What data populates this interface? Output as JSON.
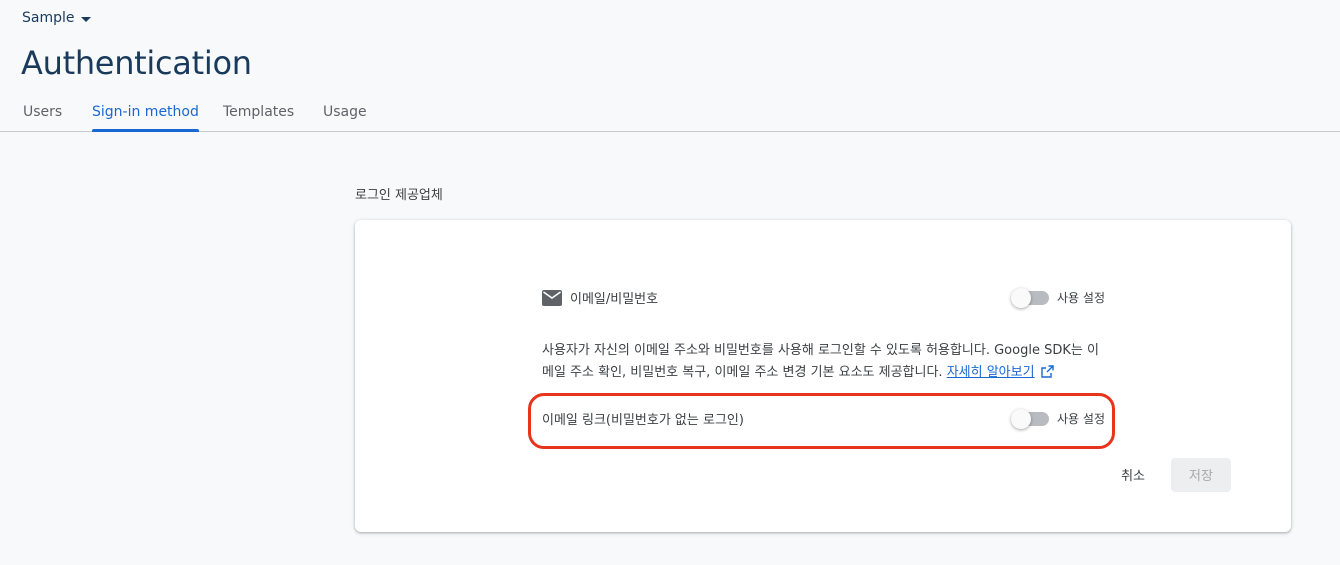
{
  "header": {
    "project_name": "Sample",
    "page_title": "Authentication"
  },
  "tabs": [
    {
      "label": "Users",
      "active": false
    },
    {
      "label": "Sign-in method",
      "active": true
    },
    {
      "label": "Templates",
      "active": false
    },
    {
      "label": "Usage",
      "active": false
    }
  ],
  "providers": {
    "section_title": "로그인 제공업체",
    "email_password": {
      "icon": "mail-icon",
      "label": "이메일/비밀번호",
      "toggle_label": "사용 설정",
      "enabled": false,
      "description": "사용자가 자신의 이메일 주소와 비밀번호를 사용해 로그인할 수 있도록 허용합니다. Google SDK는 이메일 주소 확인, 비밀번호 복구, 이메일 주소 변경 기본 요소도 제공합니다.",
      "learn_more": "자세히 알아보기"
    },
    "email_link": {
      "label": "이메일 링크(비밀번호가 없는 로그인)",
      "toggle_label": "사용 설정",
      "enabled": false
    },
    "actions": {
      "cancel": "취소",
      "save": "저장"
    }
  },
  "colors": {
    "accent": "#1967d2",
    "title": "#1a3a5c",
    "highlight": "#e8341c"
  }
}
